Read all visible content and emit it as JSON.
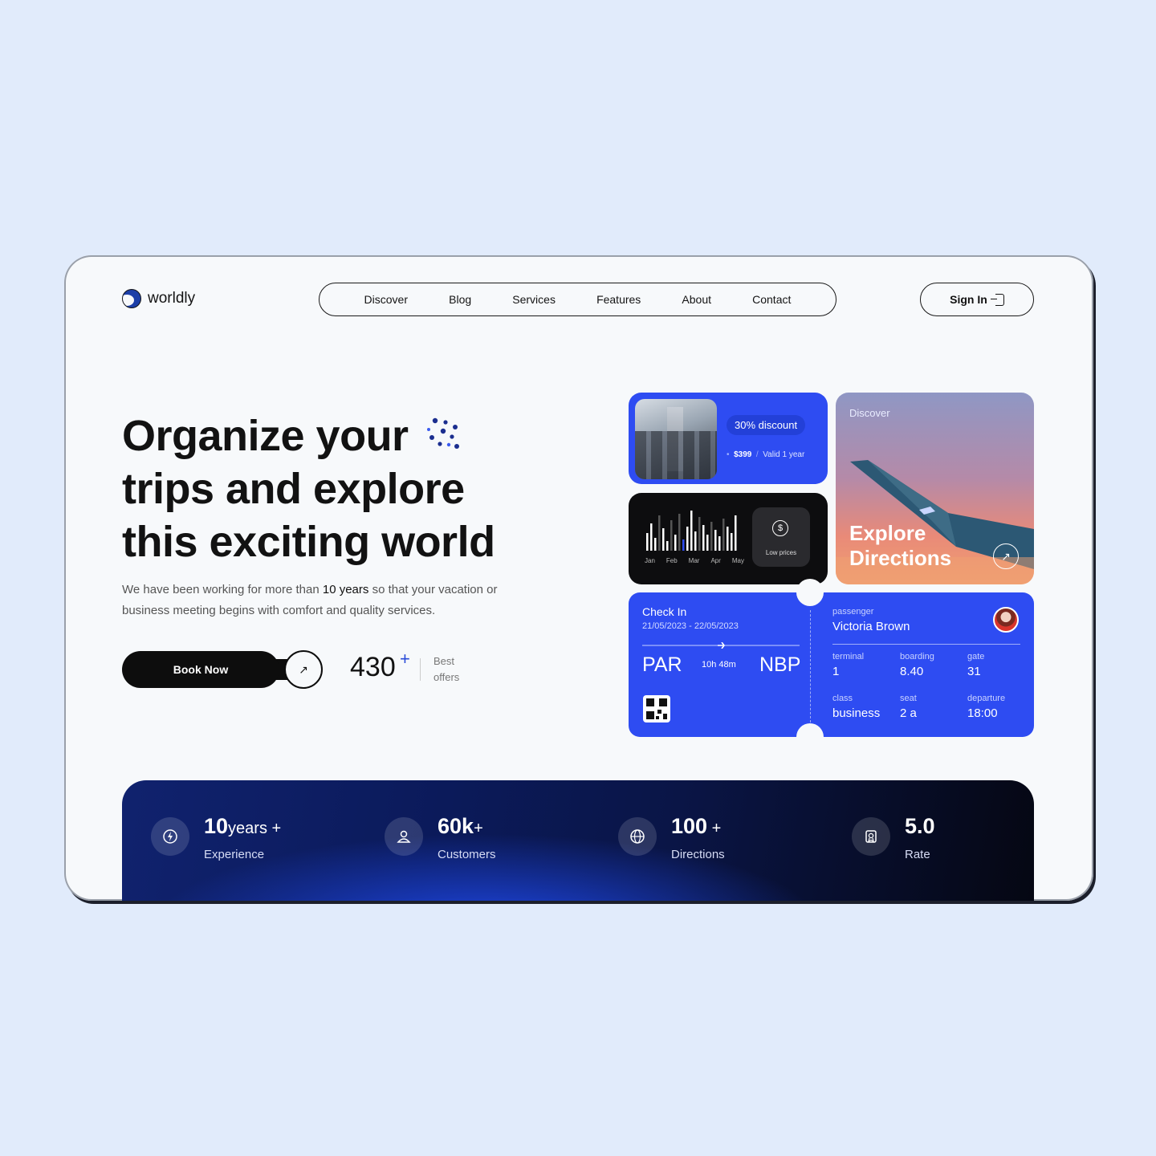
{
  "brand": {
    "name": "worldly"
  },
  "nav": {
    "items": [
      "Discover",
      "Blog",
      "Services",
      "Features",
      "About",
      "Contact"
    ]
  },
  "header": {
    "signin_label": "Sign In"
  },
  "hero": {
    "title": "Organize your trips and explore this exciting world",
    "desc_prefix": "We have been working for more than ",
    "desc_bold": "10 years",
    "desc_suffix": " so that your vacation or business meeting begins with comfort and quality services.",
    "book_label": "Book Now",
    "offers_value": "430",
    "offers_plus": "+",
    "offers_label": "Best offers"
  },
  "discount_card": {
    "badge": "30% discount",
    "price": "$399",
    "sep": "/",
    "validity": "Valid 1 year"
  },
  "price_chart": {
    "months": [
      "Jan",
      "Feb",
      "Mar",
      "Apr",
      "May"
    ],
    "low_label": "Low prices",
    "coin_symbol": "$"
  },
  "explore_card": {
    "label": "Discover",
    "title": "Explore Directions"
  },
  "ticket": {
    "checkin_label": "Check In",
    "dates": "21/05/2023 - 22/05/2023",
    "from": "PAR",
    "duration": "10h 48m",
    "to": "NBP",
    "passenger_label": "passenger",
    "passenger_name": "Victoria Brown",
    "fields": [
      {
        "label": "terminal",
        "value": "1"
      },
      {
        "label": "boarding",
        "value": "8.40"
      },
      {
        "label": "gate",
        "value": "31"
      },
      {
        "label": "class",
        "value": "business"
      },
      {
        "label": "seat",
        "value": "2 a"
      },
      {
        "label": "departure",
        "value": "18:00"
      }
    ]
  },
  "stats": [
    {
      "value": "10",
      "unit": "years +",
      "label": "Experience",
      "icon": "bolt-icon"
    },
    {
      "value": "60k",
      "unit": "+",
      "label": "Customers",
      "icon": "user-icon"
    },
    {
      "value": "100",
      "unit": " +",
      "label": "Directions",
      "icon": "globe-icon"
    },
    {
      "value": "5.0",
      "unit": "",
      "label": "Rate",
      "icon": "badge-icon"
    }
  ],
  "colors": {
    "accent": "#2e4cf2",
    "dark": "#0d0d0d",
    "page_bg": "#e1ebfb"
  }
}
